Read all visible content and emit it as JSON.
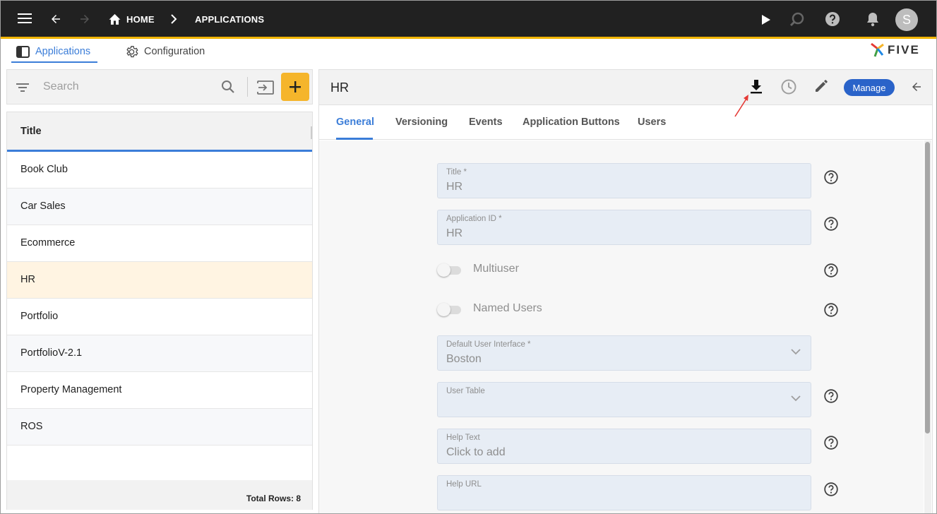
{
  "topbar": {
    "home_label": "HOME",
    "applications_label": "APPLICATIONS",
    "avatar_initial": "S",
    "accent_color": "#f0b400"
  },
  "module_tabs": {
    "applications_label": "Applications",
    "configuration_label": "Configuration"
  },
  "logo": {
    "text": "FIVE"
  },
  "search": {
    "placeholder": "Search"
  },
  "list": {
    "column_header": "Title",
    "rows": [
      {
        "label": "Book Club"
      },
      {
        "label": "Car Sales"
      },
      {
        "label": "Ecommerce"
      },
      {
        "label": "HR",
        "selected": true
      },
      {
        "label": "Portfolio"
      },
      {
        "label": "PortfolioV-2.1"
      },
      {
        "label": "Property Management"
      },
      {
        "label": "ROS"
      }
    ],
    "footer_label": "Total Rows: 8"
  },
  "detail": {
    "title": "HR",
    "manage_label": "Manage",
    "tabs": [
      {
        "label": "General",
        "active": true
      },
      {
        "label": "Versioning"
      },
      {
        "label": "Events"
      },
      {
        "label": "Application Buttons"
      },
      {
        "label": "Users"
      }
    ]
  },
  "form": {
    "title": {
      "label": "Title *",
      "value": "HR"
    },
    "application_id": {
      "label": "Application ID *",
      "value": "HR"
    },
    "multiuser": {
      "label": "Multiuser",
      "checked": false
    },
    "named_users": {
      "label": "Named Users",
      "checked": false
    },
    "default_ui": {
      "label": "Default User Interface *",
      "value": "Boston"
    },
    "user_table": {
      "label": "User Table",
      "value": ""
    },
    "help_text": {
      "label": "Help Text",
      "value": "Click to add"
    },
    "help_url": {
      "label": "Help URL",
      "value": ""
    }
  }
}
